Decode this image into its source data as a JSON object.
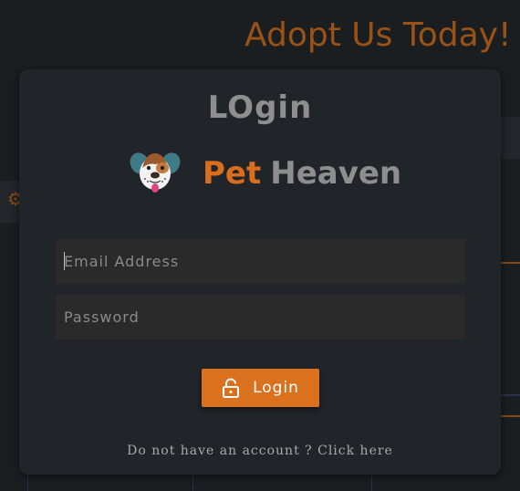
{
  "background": {
    "page_title": "Adopt Us Today!",
    "accent_color": "#d96f1d"
  },
  "modal": {
    "heading": "LOgin",
    "brand": {
      "logo_icon": "dog-face-icon",
      "name_first": "Pet",
      "name_second": "Heaven"
    },
    "email": {
      "placeholder": "Email Address",
      "value": ""
    },
    "password": {
      "placeholder": "Password",
      "value": ""
    },
    "login_button": {
      "label": "Login",
      "icon": "lock-icon",
      "color": "#d9711f"
    },
    "signup_link": "Do not have an account ? Click here"
  }
}
